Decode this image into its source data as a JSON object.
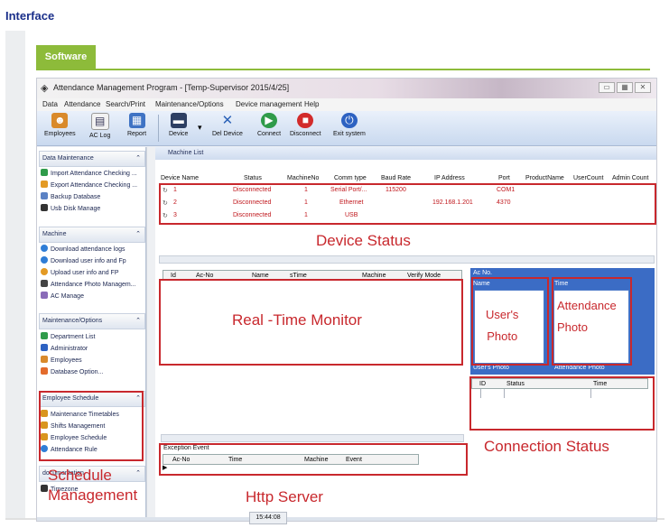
{
  "page": {
    "heading": "Interface",
    "tab": "Software"
  },
  "window": {
    "title": "Attendance Management Program - [Temp-Supervisor 2015/4/25]",
    "menu": [
      "Data",
      "Attendance",
      "Search/Print",
      "Maintenance/Options",
      "Device management",
      "Help"
    ]
  },
  "toolbar": {
    "buttons": [
      "Employees",
      "AC Log",
      "Report",
      "Device",
      "Del Device",
      "Connect",
      "Disconnect",
      "Exit system"
    ]
  },
  "sidebar": {
    "sections": [
      {
        "title": "Data Maintenance",
        "items": [
          "Import Attendance Checking ...",
          "Export Attendance Checking ...",
          "Backup Database",
          "Usb Disk Manage"
        ]
      },
      {
        "title": "Machine",
        "items": [
          "Download attendance logs",
          "Download user info and Fp",
          "Upload user info and FP",
          "Attendance Photo Managem...",
          "AC Manage"
        ]
      },
      {
        "title": "Maintenance/Options",
        "items": [
          "Department List",
          "Administrator",
          "Employees",
          "Database Option..."
        ]
      },
      {
        "title": "Employee Schedule",
        "items": [
          "Maintenance Timetables",
          "Shifts Management",
          "Employee Schedule",
          "Attendance Rule"
        ]
      },
      {
        "title": "documentation",
        "items": [
          "Timezone"
        ]
      }
    ]
  },
  "machine_list": {
    "tab": "Machine List",
    "columns": [
      "Device Name",
      "Status",
      "MachineNo",
      "Comm type",
      "Baud Rate",
      "IP Address",
      "Port",
      "ProductName",
      "UserCount",
      "Admin Count"
    ],
    "rows": [
      [
        "1",
        "Disconnected",
        "1",
        "Serial Port/...",
        "115200",
        "",
        "COM1"
      ],
      [
        "2",
        "Disconnected",
        "1",
        "Ethernet",
        "",
        "192.168.1.201",
        "4370"
      ],
      [
        "3",
        "Disconnected",
        "1",
        "USB",
        "",
        "",
        ""
      ]
    ]
  },
  "monitor": {
    "columns": [
      "Id",
      "Ac-No",
      "Name",
      "sTime",
      "Machine",
      "Verify Mode"
    ]
  },
  "photo_panel": {
    "ac_no": "Ac No.",
    "name": "Name",
    "time": "Time",
    "users_photo": "User's Photo",
    "attendance_photo": "Attendance Photo"
  },
  "connection": {
    "columns": [
      "ID",
      "Status",
      "Time"
    ]
  },
  "exception": {
    "title": "Exception Event",
    "columns": [
      "Ac-No",
      "Time",
      "Machine",
      "Event"
    ]
  },
  "status": {
    "time": "15:44:08"
  },
  "annotations": {
    "device_status": "Device Status",
    "realtime_monitor": "Real -Time Monitor",
    "users_photo": [
      "User's",
      "Photo"
    ],
    "attendance_photo": [
      "Attendance",
      "Photo"
    ],
    "connection_status": "Connection Status",
    "schedule_management": [
      "Schedule",
      "Management"
    ],
    "http_server": "Http Server"
  },
  "colors": {
    "accent_green": "#8dbb3a",
    "annotation_red": "#c8282d",
    "panel_blue": "#3b6cc5",
    "heading_blue": "#1a2f8a"
  }
}
